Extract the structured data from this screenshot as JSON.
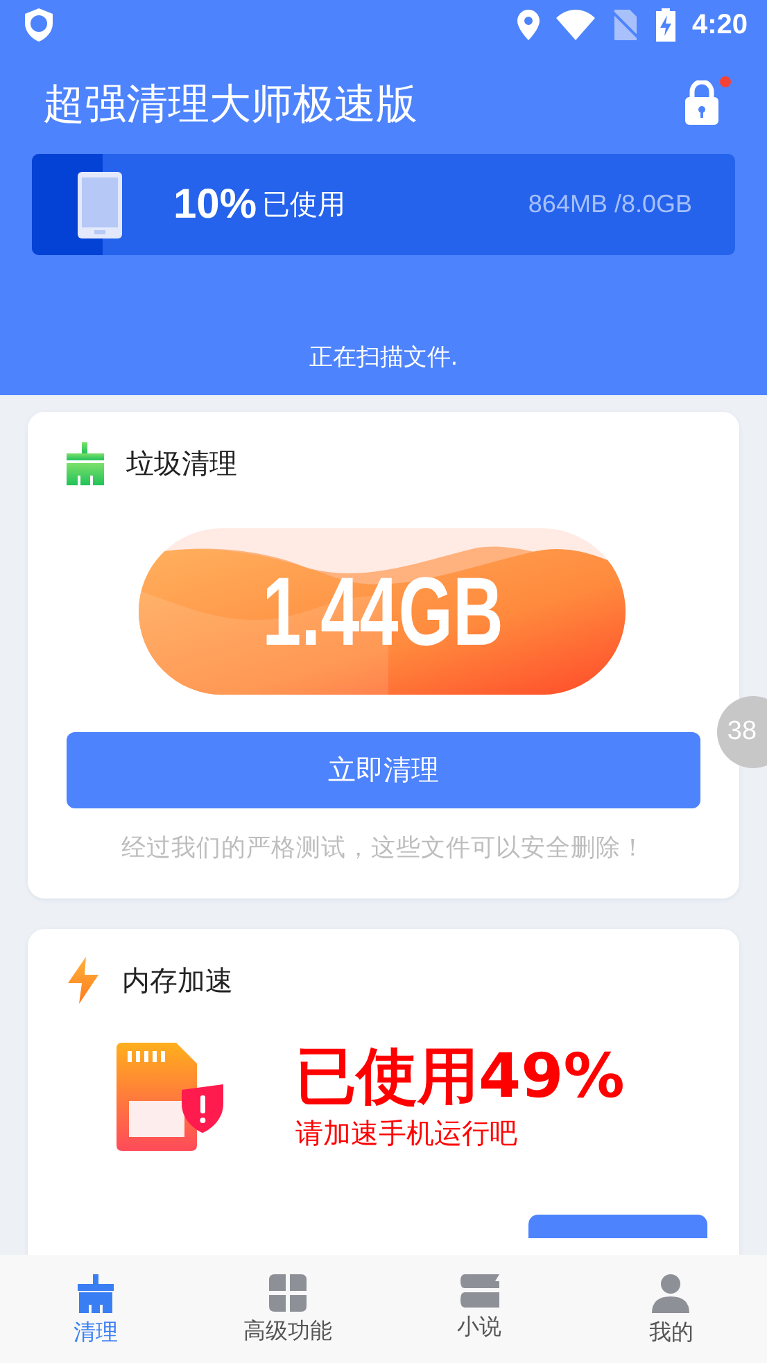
{
  "status_bar": {
    "time": "4:20"
  },
  "header": {
    "title": "超强清理大师极速版",
    "lock_badge": true,
    "storage": {
      "percent": "10%",
      "label": "已使用",
      "level": 0.1,
      "size": "864MB /8.0GB"
    },
    "scan_status": "正在扫描文件."
  },
  "junk_card": {
    "title": "垃圾清理",
    "amount": "1.44GB",
    "button": "立即清理",
    "note": "经过我们的严格测试，这些文件可以安全删除！"
  },
  "floating_badge": "38",
  "memory_card": {
    "title": "内存加速",
    "usage": "已使用49%",
    "hint": "请加速手机运行吧"
  },
  "bottom_nav": [
    {
      "label": "清理",
      "kind": "broom",
      "selected": true
    },
    {
      "label": "高级功能",
      "kind": "grid",
      "selected": false
    },
    {
      "label": "小说",
      "kind": "books",
      "selected": false
    },
    {
      "label": "我的",
      "kind": "person",
      "selected": false
    }
  ]
}
